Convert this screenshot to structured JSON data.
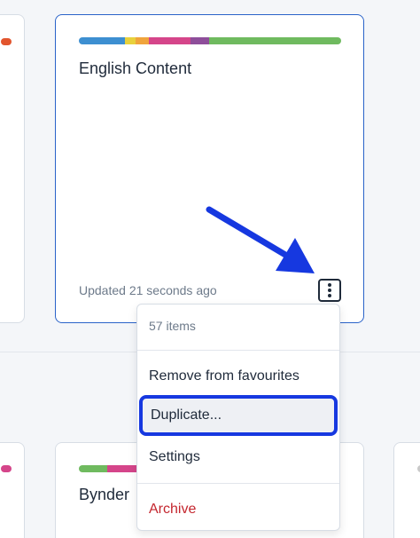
{
  "cards": {
    "main": {
      "title": "English Content",
      "updated": "Updated 21 seconds ago",
      "color_bar": [
        "#3d8fd1",
        "#e8d13c",
        "#f0a43c",
        "#d5458a",
        "#8e4e9a",
        "#6fba5f"
      ]
    },
    "bynder": {
      "title": "Bynder",
      "color_bar": [
        "#6fba5f",
        "#d5458a"
      ]
    },
    "left_top": {
      "color_bar": [
        "#e2552e"
      ]
    },
    "left_bottom": {
      "color_bar": [
        "#d5458a"
      ]
    },
    "right_bottom": {
      "color_bar": [
        "#c9c9c9"
      ]
    }
  },
  "context_menu": {
    "count": "57 items",
    "remove_label": "Remove from favourites",
    "duplicate_label": "Duplicate...",
    "settings_label": "Settings",
    "archive_label": "Archive"
  },
  "annotation": {
    "arrow_color": "#1638e0",
    "highlight_color": "#1638e0"
  },
  "icons": {
    "kebab": "more-vertical-icon"
  }
}
